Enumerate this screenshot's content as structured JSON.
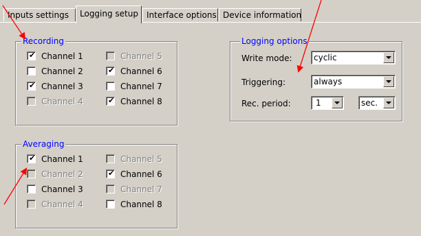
{
  "tabs": [
    {
      "label": "Inputs settings"
    },
    {
      "label": "Logging setup"
    },
    {
      "label": "Interface options"
    },
    {
      "label": "Device information"
    }
  ],
  "recording": {
    "title": "Recording",
    "channels": [
      {
        "label": "Channel 1",
        "checked": true,
        "enabled": true
      },
      {
        "label": "Channel 2",
        "checked": false,
        "enabled": true
      },
      {
        "label": "Channel 3",
        "checked": true,
        "enabled": true
      },
      {
        "label": "Channel 4",
        "checked": false,
        "enabled": false
      },
      {
        "label": "Channel 5",
        "checked": false,
        "enabled": false
      },
      {
        "label": "Channel 6",
        "checked": true,
        "enabled": true
      },
      {
        "label": "Channel 7",
        "checked": false,
        "enabled": true
      },
      {
        "label": "Channel 8",
        "checked": true,
        "enabled": true
      }
    ]
  },
  "averaging": {
    "title": "Averaging",
    "channels": [
      {
        "label": "Channel 1",
        "checked": true,
        "enabled": true
      },
      {
        "label": "Channel 2",
        "checked": false,
        "enabled": false
      },
      {
        "label": "Channel 3",
        "checked": false,
        "enabled": true
      },
      {
        "label": "Channel 4",
        "checked": false,
        "enabled": false
      },
      {
        "label": "Channel 5",
        "checked": false,
        "enabled": false
      },
      {
        "label": "Channel 6",
        "checked": true,
        "enabled": true
      },
      {
        "label": "Channel 7",
        "checked": false,
        "enabled": false
      },
      {
        "label": "Channel 8",
        "checked": false,
        "enabled": true
      }
    ]
  },
  "logging_options": {
    "title": "Logging options",
    "write_mode": {
      "label": "Write mode:",
      "value": "cyclic"
    },
    "triggering": {
      "label": "Triggering:",
      "value": "always"
    },
    "rec_period": {
      "label": "Rec. period:",
      "value": "1",
      "unit": "sec."
    }
  },
  "colors": {
    "dialog_bg": "#d4d0c8",
    "group_title": "#0000ff",
    "annotation_arrow": "#ff0000"
  }
}
